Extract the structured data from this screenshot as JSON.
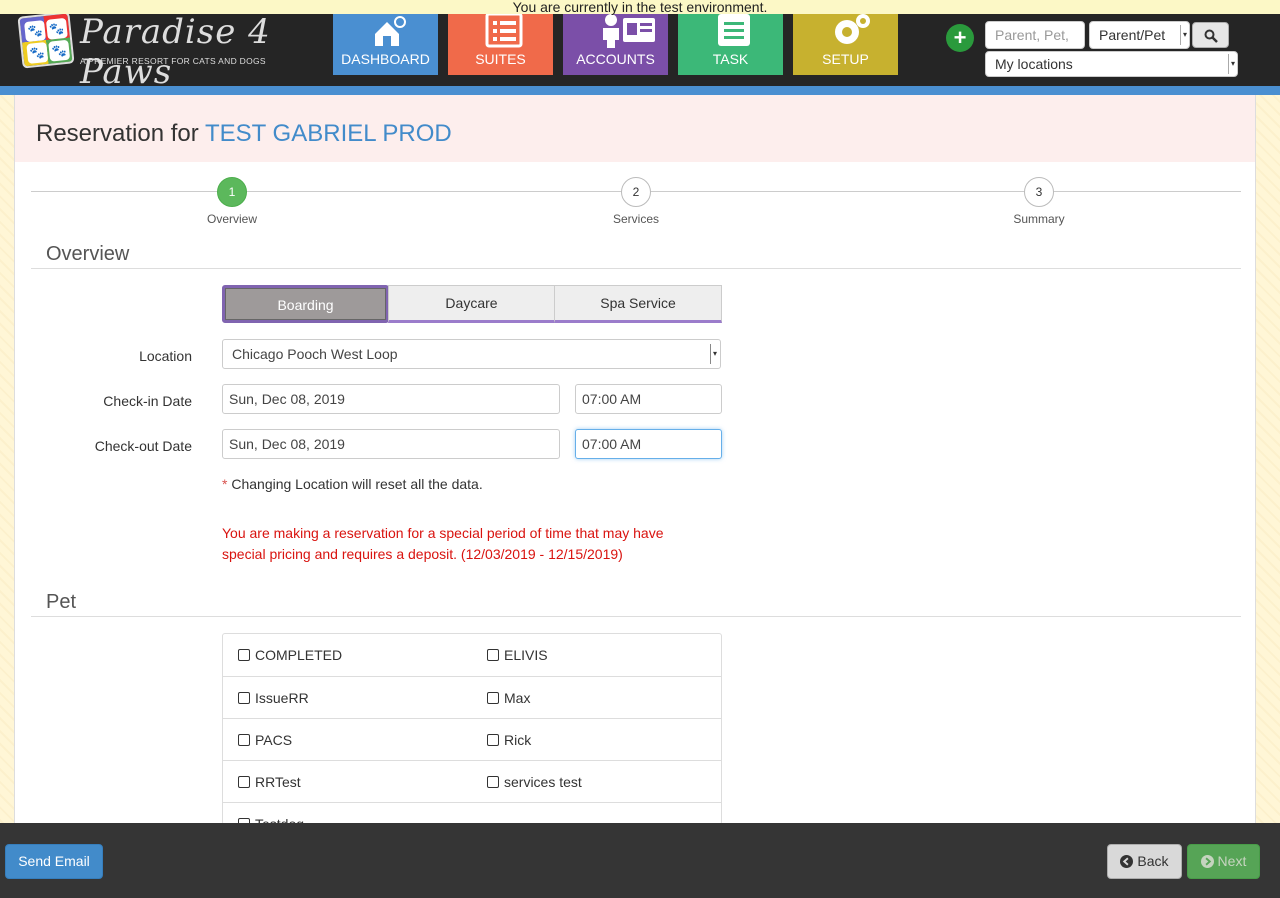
{
  "env_notice": "You are currently in the test environment.",
  "brand": {
    "name": "Paradise 4 Paws",
    "tagline": "A PREMIER RESORT FOR CATS AND DOGS"
  },
  "nav": [
    {
      "label": "DASHBOARD",
      "icon": "house-tag-icon",
      "color": "#4a8fd1"
    },
    {
      "label": "SUITES",
      "icon": "list-icon",
      "color": "#f06a4a"
    },
    {
      "label": "ACCOUNTS",
      "icon": "id-card-icon",
      "color": "#7b4fa8"
    },
    {
      "label": "TASK",
      "icon": "clipboard-icon",
      "color": "#3cb878"
    },
    {
      "label": "SETUP",
      "icon": "gears-icon",
      "color": "#c7b12f"
    }
  ],
  "search": {
    "placeholder": "Parent, Pet, E",
    "type_value": "Parent/Pet",
    "locations_value": "My locations"
  },
  "page": {
    "title_prefix": "Reservation for",
    "customer": "TEST GABRIEL PROD"
  },
  "steps": [
    {
      "num": "1",
      "label": "Overview",
      "active": true
    },
    {
      "num": "2",
      "label": "Services",
      "active": false
    },
    {
      "num": "3",
      "label": "Summary",
      "active": false
    }
  ],
  "overview": {
    "heading": "Overview",
    "tabs": [
      "Boarding",
      "Daycare",
      "Spa Service"
    ],
    "active_tab": "Boarding",
    "location_label": "Location",
    "location_value": "Chicago Pooch West Loop",
    "checkin_label": "Check-in Date",
    "checkin_date": "Sun, Dec 08, 2019",
    "checkin_time": "07:00 AM",
    "checkout_label": "Check-out Date",
    "checkout_date": "Sun, Dec 08, 2019",
    "checkout_time": "07:00 AM",
    "note_star": "*",
    "note": "Changing Location will reset all the data.",
    "warning": "You are making a reservation for a special period of time that may have special pricing and requires a deposit. (12/03/2019 - 12/15/2019)"
  },
  "pet": {
    "heading": "Pet",
    "rows": [
      [
        "COMPLETED",
        "ELIVIS"
      ],
      [
        "IssueRR",
        "Max"
      ],
      [
        "PACS",
        "Rick"
      ],
      [
        "RRTest",
        "services test"
      ],
      [
        "Testdog",
        ""
      ]
    ]
  },
  "footer": {
    "send_email": "Send Email",
    "back": "Back",
    "next": "Next"
  },
  "colors": {
    "accent": "#428bca",
    "warning": "#d9130f",
    "success": "#5cb85c"
  }
}
